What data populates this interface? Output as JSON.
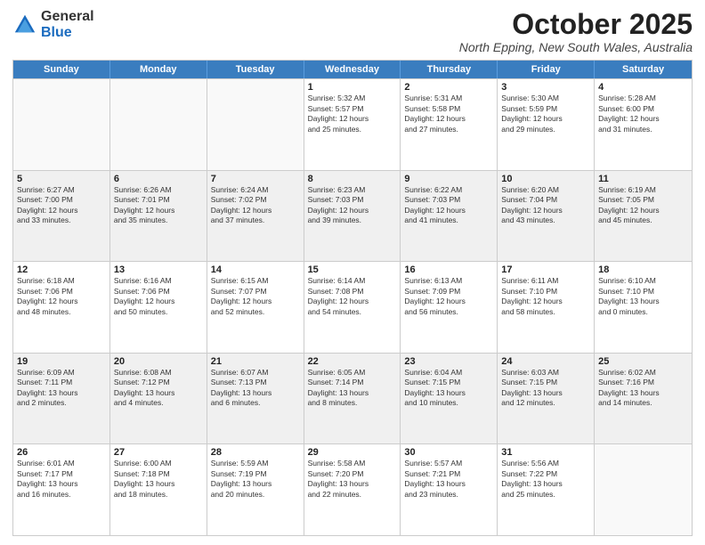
{
  "logo": {
    "general": "General",
    "blue": "Blue"
  },
  "header": {
    "month": "October 2025",
    "location": "North Epping, New South Wales, Australia"
  },
  "day_headers": [
    "Sunday",
    "Monday",
    "Tuesday",
    "Wednesday",
    "Thursday",
    "Friday",
    "Saturday"
  ],
  "weeks": [
    [
      {
        "day": "",
        "info": ""
      },
      {
        "day": "",
        "info": ""
      },
      {
        "day": "",
        "info": ""
      },
      {
        "day": "1",
        "info": "Sunrise: 5:32 AM\nSunset: 5:57 PM\nDaylight: 12 hours\nand 25 minutes."
      },
      {
        "day": "2",
        "info": "Sunrise: 5:31 AM\nSunset: 5:58 PM\nDaylight: 12 hours\nand 27 minutes."
      },
      {
        "day": "3",
        "info": "Sunrise: 5:30 AM\nSunset: 5:59 PM\nDaylight: 12 hours\nand 29 minutes."
      },
      {
        "day": "4",
        "info": "Sunrise: 5:28 AM\nSunset: 6:00 PM\nDaylight: 12 hours\nand 31 minutes."
      }
    ],
    [
      {
        "day": "5",
        "info": "Sunrise: 6:27 AM\nSunset: 7:00 PM\nDaylight: 12 hours\nand 33 minutes."
      },
      {
        "day": "6",
        "info": "Sunrise: 6:26 AM\nSunset: 7:01 PM\nDaylight: 12 hours\nand 35 minutes."
      },
      {
        "day": "7",
        "info": "Sunrise: 6:24 AM\nSunset: 7:02 PM\nDaylight: 12 hours\nand 37 minutes."
      },
      {
        "day": "8",
        "info": "Sunrise: 6:23 AM\nSunset: 7:03 PM\nDaylight: 12 hours\nand 39 minutes."
      },
      {
        "day": "9",
        "info": "Sunrise: 6:22 AM\nSunset: 7:03 PM\nDaylight: 12 hours\nand 41 minutes."
      },
      {
        "day": "10",
        "info": "Sunrise: 6:20 AM\nSunset: 7:04 PM\nDaylight: 12 hours\nand 43 minutes."
      },
      {
        "day": "11",
        "info": "Sunrise: 6:19 AM\nSunset: 7:05 PM\nDaylight: 12 hours\nand 45 minutes."
      }
    ],
    [
      {
        "day": "12",
        "info": "Sunrise: 6:18 AM\nSunset: 7:06 PM\nDaylight: 12 hours\nand 48 minutes."
      },
      {
        "day": "13",
        "info": "Sunrise: 6:16 AM\nSunset: 7:06 PM\nDaylight: 12 hours\nand 50 minutes."
      },
      {
        "day": "14",
        "info": "Sunrise: 6:15 AM\nSunset: 7:07 PM\nDaylight: 12 hours\nand 52 minutes."
      },
      {
        "day": "15",
        "info": "Sunrise: 6:14 AM\nSunset: 7:08 PM\nDaylight: 12 hours\nand 54 minutes."
      },
      {
        "day": "16",
        "info": "Sunrise: 6:13 AM\nSunset: 7:09 PM\nDaylight: 12 hours\nand 56 minutes."
      },
      {
        "day": "17",
        "info": "Sunrise: 6:11 AM\nSunset: 7:10 PM\nDaylight: 12 hours\nand 58 minutes."
      },
      {
        "day": "18",
        "info": "Sunrise: 6:10 AM\nSunset: 7:10 PM\nDaylight: 13 hours\nand 0 minutes."
      }
    ],
    [
      {
        "day": "19",
        "info": "Sunrise: 6:09 AM\nSunset: 7:11 PM\nDaylight: 13 hours\nand 2 minutes."
      },
      {
        "day": "20",
        "info": "Sunrise: 6:08 AM\nSunset: 7:12 PM\nDaylight: 13 hours\nand 4 minutes."
      },
      {
        "day": "21",
        "info": "Sunrise: 6:07 AM\nSunset: 7:13 PM\nDaylight: 13 hours\nand 6 minutes."
      },
      {
        "day": "22",
        "info": "Sunrise: 6:05 AM\nSunset: 7:14 PM\nDaylight: 13 hours\nand 8 minutes."
      },
      {
        "day": "23",
        "info": "Sunrise: 6:04 AM\nSunset: 7:15 PM\nDaylight: 13 hours\nand 10 minutes."
      },
      {
        "day": "24",
        "info": "Sunrise: 6:03 AM\nSunset: 7:15 PM\nDaylight: 13 hours\nand 12 minutes."
      },
      {
        "day": "25",
        "info": "Sunrise: 6:02 AM\nSunset: 7:16 PM\nDaylight: 13 hours\nand 14 minutes."
      }
    ],
    [
      {
        "day": "26",
        "info": "Sunrise: 6:01 AM\nSunset: 7:17 PM\nDaylight: 13 hours\nand 16 minutes."
      },
      {
        "day": "27",
        "info": "Sunrise: 6:00 AM\nSunset: 7:18 PM\nDaylight: 13 hours\nand 18 minutes."
      },
      {
        "day": "28",
        "info": "Sunrise: 5:59 AM\nSunset: 7:19 PM\nDaylight: 13 hours\nand 20 minutes."
      },
      {
        "day": "29",
        "info": "Sunrise: 5:58 AM\nSunset: 7:20 PM\nDaylight: 13 hours\nand 22 minutes."
      },
      {
        "day": "30",
        "info": "Sunrise: 5:57 AM\nSunset: 7:21 PM\nDaylight: 13 hours\nand 23 minutes."
      },
      {
        "day": "31",
        "info": "Sunrise: 5:56 AM\nSunset: 7:22 PM\nDaylight: 13 hours\nand 25 minutes."
      },
      {
        "day": "",
        "info": ""
      }
    ]
  ]
}
